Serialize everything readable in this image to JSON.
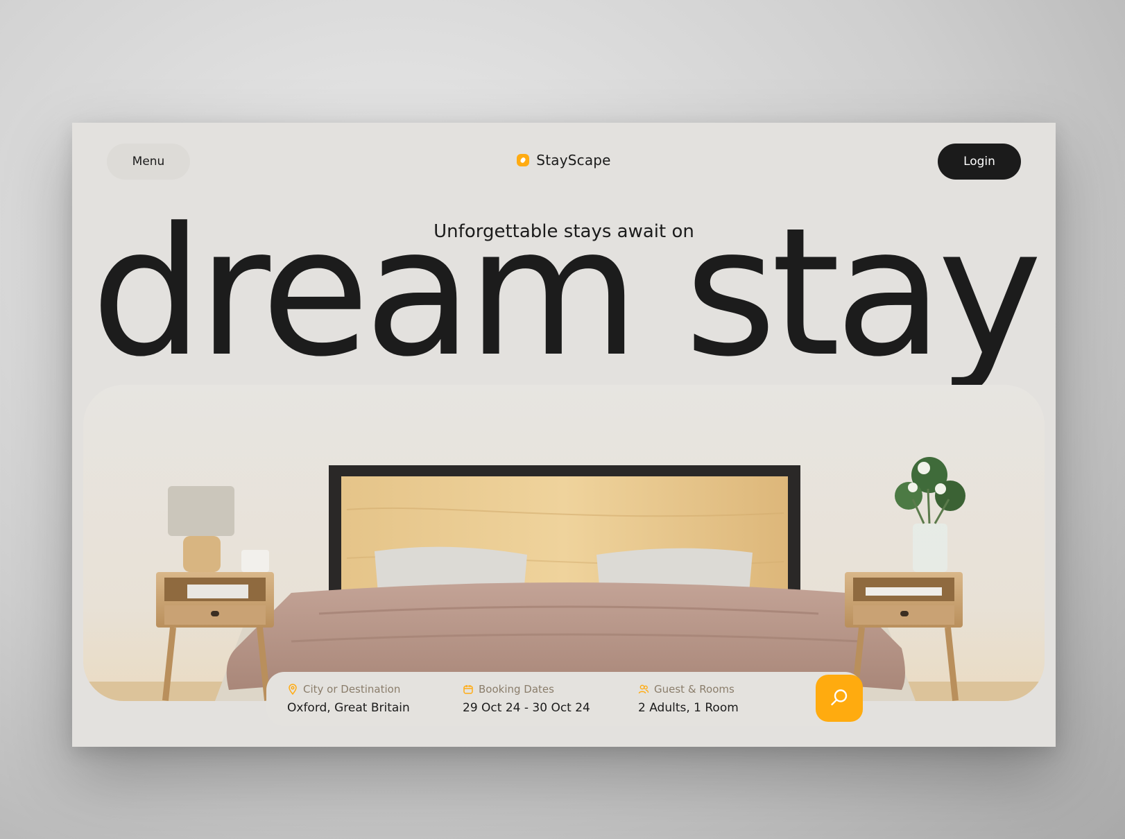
{
  "header": {
    "menu_label": "Menu",
    "brand_name": "StayScape",
    "login_label": "Login"
  },
  "hero": {
    "tagline": "Unforgettable stays await on",
    "headline": "dream stay"
  },
  "search": {
    "destination": {
      "label": "City or Destination",
      "value": "Oxford, Great Britain",
      "icon": "location-pin-icon"
    },
    "dates": {
      "label": "Booking Dates",
      "value": "29 Oct 24 - 30 Oct 24",
      "icon": "calendar-icon"
    },
    "guests": {
      "label": "Guest & Rooms",
      "value": "2 Adults, 1 Room",
      "icon": "users-icon"
    },
    "button_icon": "search-icon"
  },
  "colors": {
    "accent": "#ffab12",
    "dark": "#1b1b1b",
    "card_bg": "#e3e1de"
  }
}
